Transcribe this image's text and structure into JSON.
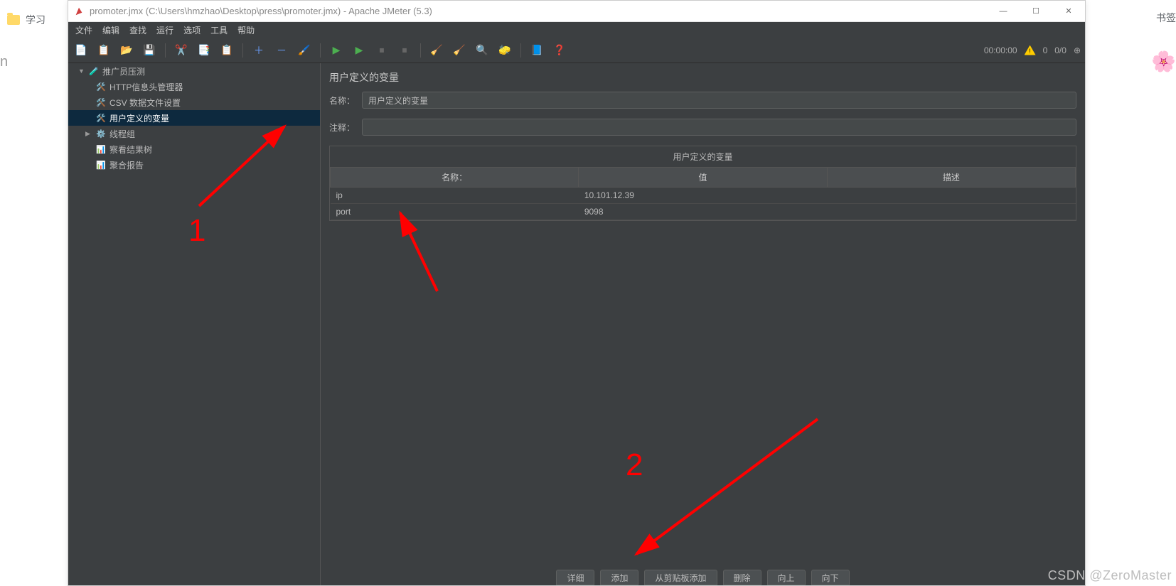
{
  "browser": {
    "tab": "学习",
    "bookmark_partial": "书签"
  },
  "misc": {
    "n": "n"
  },
  "window": {
    "title": "promoter.jmx (C:\\Users\\hmzhao\\Desktop\\press\\promoter.jmx) - Apache JMeter (5.3)",
    "controls": {
      "min": "—",
      "max": "☐",
      "close": "✕"
    }
  },
  "menu": {
    "items": [
      "文件",
      "编辑",
      "查找",
      "运行",
      "选项",
      "工具",
      "帮助"
    ]
  },
  "toolbar": {
    "timer": "00:00:00",
    "warn_count": "0",
    "thread_counter": "0/0"
  },
  "tree": {
    "root": "推广员压测",
    "items": [
      {
        "label": "HTTP信息头管理器"
      },
      {
        "label": "CSV 数据文件设置"
      },
      {
        "label": "用户定义的变量",
        "selected": true
      },
      {
        "label": "线程组",
        "expandable": true
      },
      {
        "label": "察看结果树"
      },
      {
        "label": "聚合报告"
      }
    ]
  },
  "panel": {
    "title": "用户定义的变量",
    "name_label": "名称：",
    "name_value": "用户定义的变量",
    "comment_label": "注释：",
    "comment_value": "",
    "table_title": "用户定义的变量",
    "columns": [
      "名称：",
      "值",
      "描述"
    ],
    "rows": [
      {
        "name": "ip",
        "value": "10.101.12.39",
        "desc": ""
      },
      {
        "name": "port",
        "value": "9098",
        "desc": ""
      }
    ],
    "buttons": [
      "详细",
      "添加",
      "从剪贴板添加",
      "删除",
      "向上",
      "向下"
    ]
  },
  "annotations": {
    "num1": "1",
    "num2": "2"
  },
  "watermark": "CSDN @ZeroMaster"
}
